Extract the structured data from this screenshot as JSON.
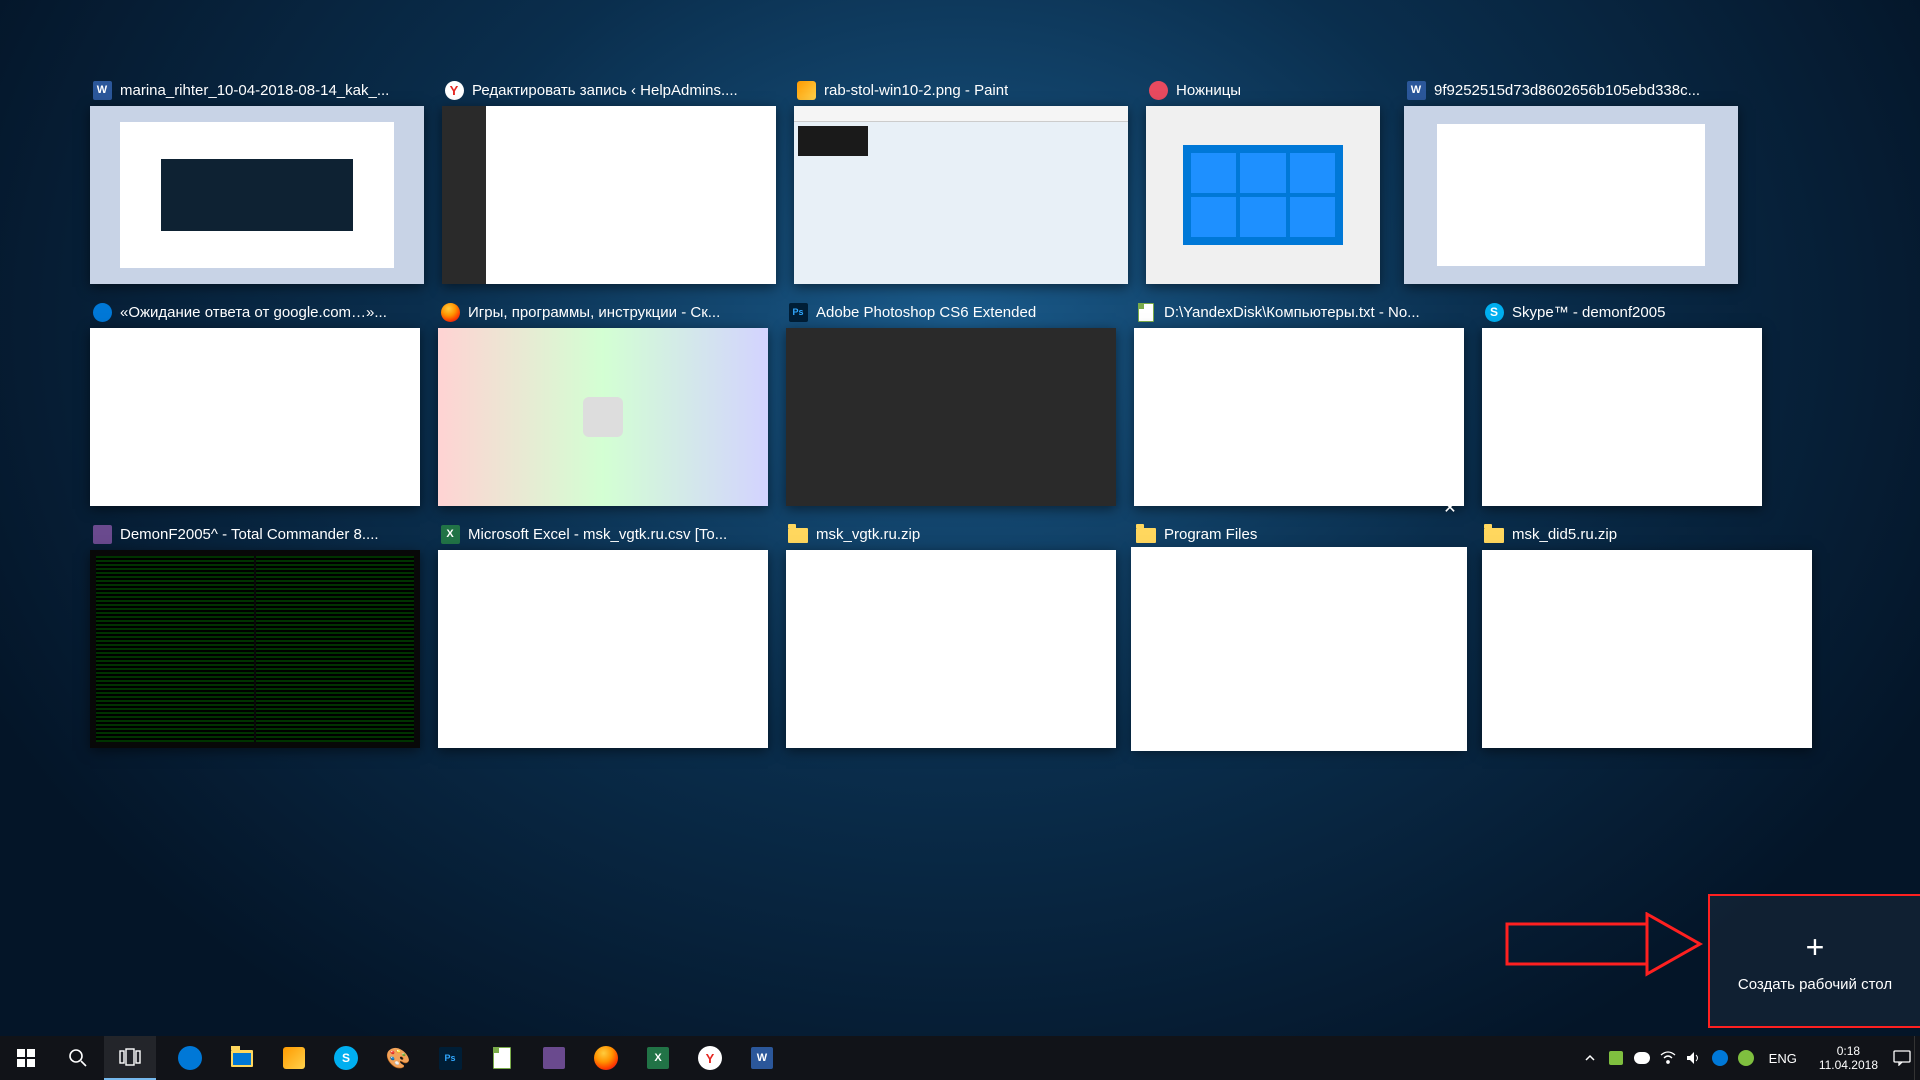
{
  "windows": {
    "r1": [
      {
        "title": "marina_rihter_10-04-2018-08-14_kak_...",
        "icon": "word"
      },
      {
        "title": "Редактировать запись ‹ HelpAdmins....",
        "icon": "yandex"
      },
      {
        "title": "rab-stol-win10-2.png - Paint",
        "icon": "paint"
      },
      {
        "title": "Ножницы",
        "icon": "snip"
      },
      {
        "title": "9f9252515d73d8602656b105ebd338c...",
        "icon": "word"
      }
    ],
    "r2": [
      {
        "title": "«Ожидание ответа от google.com…»...",
        "icon": "edge"
      },
      {
        "title": "Игры, программы, инструкции - Ск...",
        "icon": "ff"
      },
      {
        "title": "Adobe Photoshop CS6 Extended",
        "icon": "ps"
      },
      {
        "title": "D:\\YandexDisk\\Компьютеры.txt - No...",
        "icon": "notepad"
      },
      {
        "title": "Skype™ - demonf2005",
        "icon": "skype"
      }
    ],
    "r3": [
      {
        "title": "DemonF2005^ - Total Commander 8....",
        "icon": "tc"
      },
      {
        "title": "Microsoft Excel - msk_vgtk.ru.csv  [To...",
        "icon": "excel"
      },
      {
        "title": "msk_vgtk.ru.zip",
        "icon": "folder"
      },
      {
        "title": "Program Files",
        "icon": "folder",
        "selected": true,
        "close": true
      },
      {
        "title": "msk_did5.ru.zip",
        "icon": "folder"
      }
    ]
  },
  "new_desktop_label": "Создать рабочий стол",
  "close_label": "✕",
  "taskbar": {
    "lang": "ENG",
    "time": "0:18",
    "date": "11.04.2018"
  }
}
